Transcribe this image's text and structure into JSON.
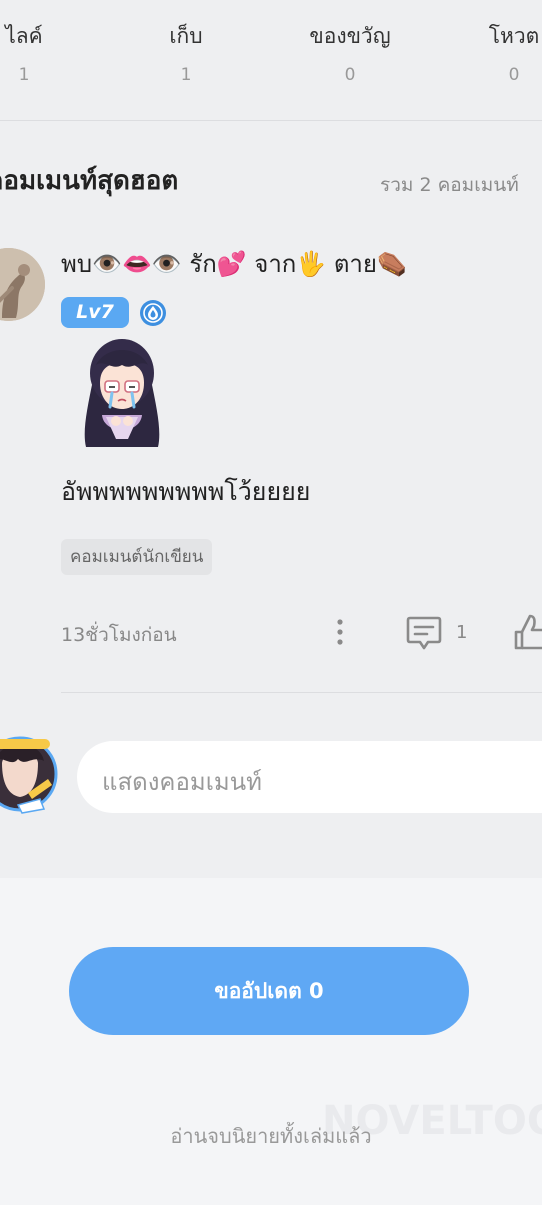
{
  "stats": [
    {
      "label": "ไลค์",
      "count": "1"
    },
    {
      "label": "เก็บ",
      "count": "1"
    },
    {
      "label": "ของขวัญ",
      "count": "0"
    },
    {
      "label": "โหวต",
      "count": "0"
    }
  ],
  "hot_comments": {
    "title": "คอมเมนท์สุดฮอต",
    "total": "รวม 2 คอมเมนท์"
  },
  "comment": {
    "username": "พบ👁️👄👁️ รัก💕 จาก🖐️ ตาย⚰️",
    "level": "Lv7",
    "text": "อัพพพพพพพพพโว้ยยยย",
    "tag": "คอมเมนต์นักเขียน",
    "time": "13ชั่วโมงก่อน",
    "reply_count": "1"
  },
  "input": {
    "placeholder": "แสดงคอมเมนท์"
  },
  "update_button": "ขออัปเดต 0",
  "end_text": "อ่านจบนิยายทั้งเล่มแล้ว",
  "watermark": "NOVELTOON",
  "colors": {
    "accent": "#5fa8f4",
    "badge": "#5aa8f2"
  }
}
